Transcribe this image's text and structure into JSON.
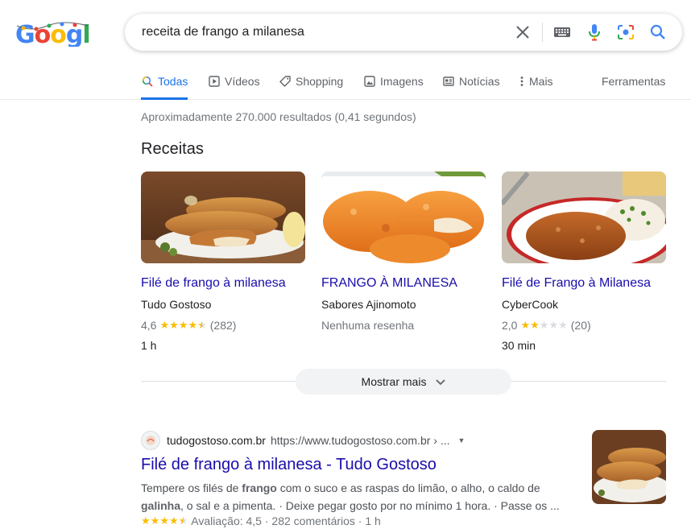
{
  "logo": {
    "text": "Google"
  },
  "search": {
    "query": "receita de frango a milanesa"
  },
  "tabs": [
    {
      "label": "Todas",
      "icon": "search-icon",
      "active": true
    },
    {
      "label": "Vídeos",
      "icon": "play-icon"
    },
    {
      "label": "Shopping",
      "icon": "tag-icon"
    },
    {
      "label": "Imagens",
      "icon": "image-icon"
    },
    {
      "label": "Notícias",
      "icon": "news-icon"
    },
    {
      "label": "Mais",
      "icon": "more-vert-icon"
    }
  ],
  "tools_label": "Ferramentas",
  "stats": "Aproximadamente 270.000 resultados (0,41 segundos)",
  "recipes": {
    "title": "Receitas",
    "cards": [
      {
        "title": "Filé de frango à milanesa",
        "source": "Tudo Gostoso",
        "rating": "4,6",
        "stars": 4.5,
        "reviews": "(282)",
        "time": "1 h"
      },
      {
        "title": "FRANGO À MILANESA",
        "source": "Sabores Ajinomoto",
        "no_reviews": "Nenhuma resenha"
      },
      {
        "title": "Filé de Frango à Milanesa",
        "source": "CyberCook",
        "rating": "2,0",
        "stars": 2,
        "reviews": "(20)",
        "time": "30 min"
      }
    ],
    "more_label": "Mostrar mais"
  },
  "result": {
    "site_name": "tudogostoso.com.br",
    "url": "https://www.tudogostoso.com.br › ...",
    "title": "Filé de frango à milanesa - Tudo Gostoso",
    "snippet": {
      "p1": "Tempere os filés de ",
      "b1": "frango",
      "p2": " com o suco e as raspas do limão, o alho, o caldo de ",
      "b2": "galinha",
      "p3": ", o sal e a pimenta. · Deixe pegar gosto por no mínimo 1 hora. · Passe os ..."
    },
    "meta": "Avaliação: 4,5 · 282 comentários · 1 h",
    "stars": 4.5
  },
  "colors": {
    "link": "#1a0dab",
    "accent": "#1a73e8",
    "star": "#fbbc04"
  }
}
